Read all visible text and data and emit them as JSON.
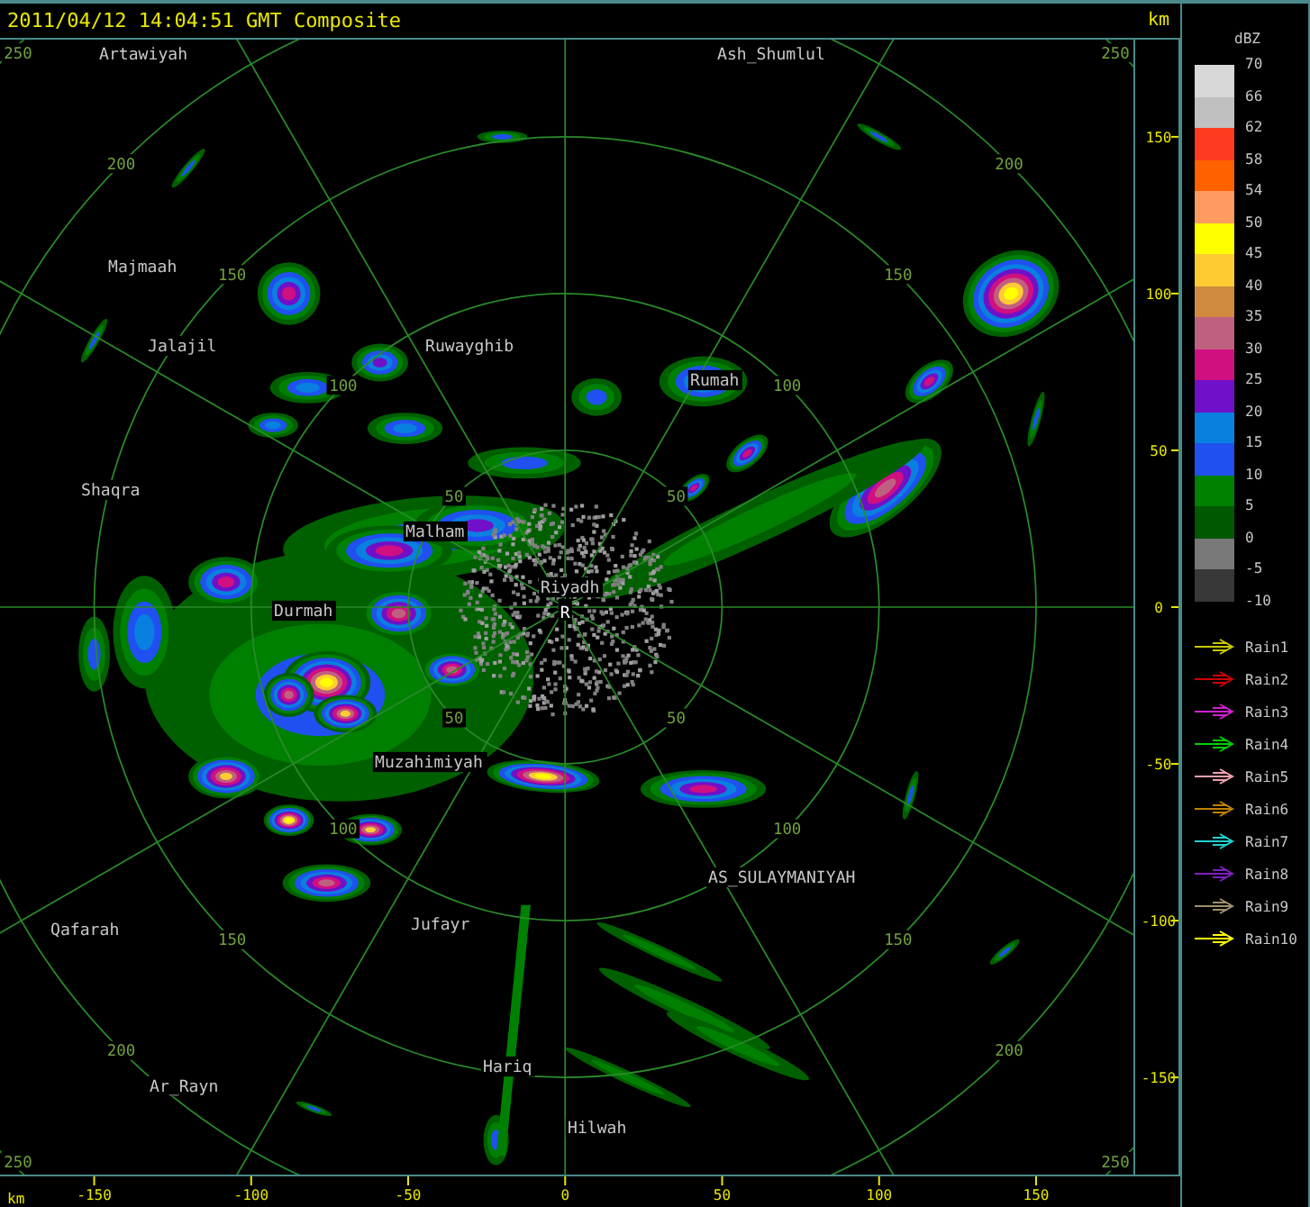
{
  "title_bar": {
    "title": "2011/04/12 14:04:51 GMT Composite",
    "unit": "km"
  },
  "map": {
    "places": [
      {
        "name": "Artawiyah"
      },
      {
        "name": "Ash_Shumlul"
      },
      {
        "name": "Majmaah"
      },
      {
        "name": "Jalajil"
      },
      {
        "name": "Ruwayghib"
      },
      {
        "name": "Shaqra"
      },
      {
        "name": "Rumah"
      },
      {
        "name": "Malham"
      },
      {
        "name": "Riyadh"
      },
      {
        "name": "Durmah"
      },
      {
        "name": "Muzahimiyah"
      },
      {
        "name": "AS_SULAYMANIYAH"
      },
      {
        "name": "Jufayr"
      },
      {
        "name": "Qafarah"
      },
      {
        "name": "Ar_Rayn"
      },
      {
        "name": "Hariq"
      },
      {
        "name": "Hilwah"
      }
    ],
    "radar_marker": "R",
    "range_rings": [
      {
        "labels": [
          "50",
          "50",
          "50",
          "50"
        ]
      },
      {
        "labels": [
          "100",
          "100",
          "100",
          "100"
        ]
      },
      {
        "labels": [
          "150",
          "150",
          "150",
          "150"
        ]
      },
      {
        "labels": [
          "200",
          "200",
          "200",
          "200"
        ]
      },
      {
        "labels": [
          "250",
          "250",
          "250",
          "250"
        ]
      }
    ]
  },
  "y_axis": {
    "ticks": [
      "150",
      "100",
      "50",
      "0",
      "-50",
      "-100",
      "-150"
    ]
  },
  "x_axis": {
    "unit": "km",
    "ticks": [
      "-150",
      "-100",
      "-50",
      "0",
      "50",
      "100",
      "150"
    ]
  },
  "legend": {
    "title": "dBZ",
    "labels": [
      "70",
      "66",
      "62",
      "58",
      "54",
      "50",
      "45",
      "40",
      "35",
      "30",
      "25",
      "20",
      "15",
      "10",
      "5",
      "0",
      "-5",
      "-10"
    ],
    "bands": [
      {
        "color": "#d8d8d8"
      },
      {
        "color": "#c0c0c0"
      },
      {
        "color": "#ff3a20"
      },
      {
        "color": "#ff6000"
      },
      {
        "color": "#ff9a60"
      },
      {
        "color": "#ffff00"
      },
      {
        "color": "#ffcc33"
      },
      {
        "color": "#d08a40"
      },
      {
        "color": "#c06080"
      },
      {
        "color": "#d01080"
      },
      {
        "color": "#7010c8"
      },
      {
        "color": "#0880e0"
      },
      {
        "color": "#2050f0"
      },
      {
        "color": "#008000"
      },
      {
        "color": "#005800"
      },
      {
        "color": "#787878"
      },
      {
        "color": "#383838"
      }
    ],
    "tracks": [
      {
        "label": "Rain1",
        "color": "#c8c800"
      },
      {
        "label": "Rain2",
        "color": "#d00000"
      },
      {
        "label": "Rain3",
        "color": "#d020d0"
      },
      {
        "label": "Rain4",
        "color": "#00d000"
      },
      {
        "label": "Rain5",
        "color": "#f0a0b0"
      },
      {
        "label": "Rain6",
        "color": "#c08000"
      },
      {
        "label": "Rain7",
        "color": "#20d0d0"
      },
      {
        "label": "Rain8",
        "color": "#8020c0"
      },
      {
        "label": "Rain9",
        "color": "#a09070"
      },
      {
        "label": "Rain10",
        "color": "#ffff00"
      }
    ]
  }
}
